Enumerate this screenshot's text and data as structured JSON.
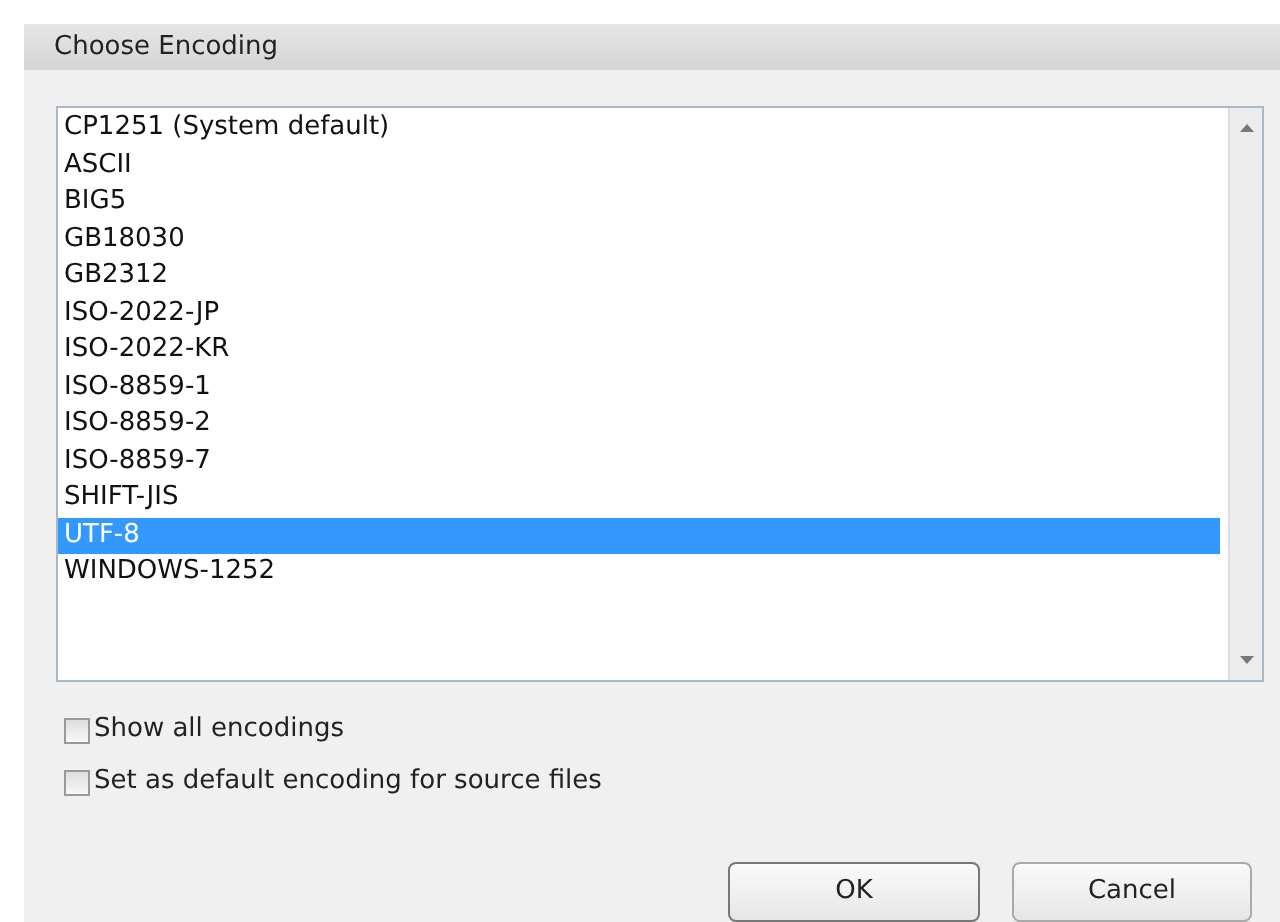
{
  "window": {
    "title": "Choose Encoding"
  },
  "encodings": [
    {
      "label": "CP1251 (System default)",
      "selected": false
    },
    {
      "label": "ASCII",
      "selected": false
    },
    {
      "label": "BIG5",
      "selected": false
    },
    {
      "label": "GB18030",
      "selected": false
    },
    {
      "label": "GB2312",
      "selected": false
    },
    {
      "label": "ISO-2022-JP",
      "selected": false
    },
    {
      "label": "ISO-2022-KR",
      "selected": false
    },
    {
      "label": "ISO-8859-1",
      "selected": false
    },
    {
      "label": "ISO-8859-2",
      "selected": false
    },
    {
      "label": "ISO-8859-7",
      "selected": false
    },
    {
      "label": "SHIFT-JIS",
      "selected": false
    },
    {
      "label": "UTF-8",
      "selected": true
    },
    {
      "label": "WINDOWS-1252",
      "selected": false
    }
  ],
  "options": [
    {
      "label": "Show all encodings",
      "checked": false
    },
    {
      "label": "Set as default encoding for source files",
      "checked": false
    }
  ],
  "buttons": [
    "OK",
    "Cancel"
  ]
}
